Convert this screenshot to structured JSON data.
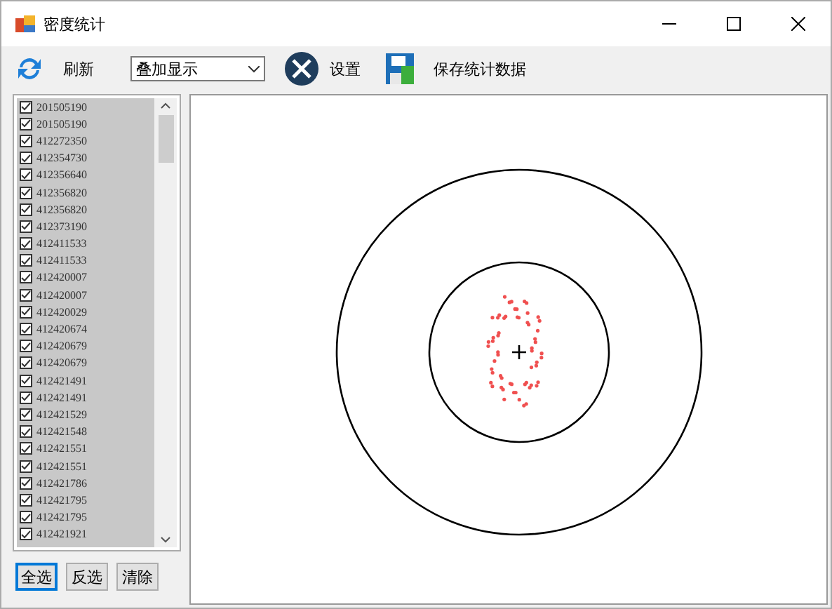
{
  "window": {
    "title": "密度统计"
  },
  "toolbar": {
    "refresh": "刷新",
    "mode": {
      "value": "叠加显示"
    },
    "settings": "设置",
    "save": "保存统计数据"
  },
  "list": {
    "items": [
      {
        "label": "201505190",
        "checked": true
      },
      {
        "label": "201505190",
        "checked": true
      },
      {
        "label": "412272350",
        "checked": true
      },
      {
        "label": "412354730",
        "checked": true
      },
      {
        "label": "412356640",
        "checked": true
      },
      {
        "label": "412356820",
        "checked": true
      },
      {
        "label": "412356820",
        "checked": true
      },
      {
        "label": "412373190",
        "checked": true
      },
      {
        "label": "412411533",
        "checked": true
      },
      {
        "label": "412411533",
        "checked": true
      },
      {
        "label": "412420007",
        "checked": true
      },
      {
        "label": "412420007",
        "checked": true
      },
      {
        "label": "412420029",
        "checked": true
      },
      {
        "label": "412420674",
        "checked": true
      },
      {
        "label": "412420679",
        "checked": true
      },
      {
        "label": "412420679",
        "checked": true
      },
      {
        "label": "412421491",
        "checked": true
      },
      {
        "label": "412421491",
        "checked": true
      },
      {
        "label": "412421529",
        "checked": true
      },
      {
        "label": "412421548",
        "checked": true
      },
      {
        "label": "412421551",
        "checked": true
      },
      {
        "label": "412421551",
        "checked": true
      },
      {
        "label": "412421786",
        "checked": true
      },
      {
        "label": "412421795",
        "checked": true
      },
      {
        "label": "412421795",
        "checked": true
      },
      {
        "label": "412421921",
        "checked": true
      }
    ]
  },
  "buttons": [
    {
      "label": "全选",
      "selected": true
    },
    {
      "label": "反选",
      "selected": false
    },
    {
      "label": "清除",
      "selected": false
    }
  ]
}
